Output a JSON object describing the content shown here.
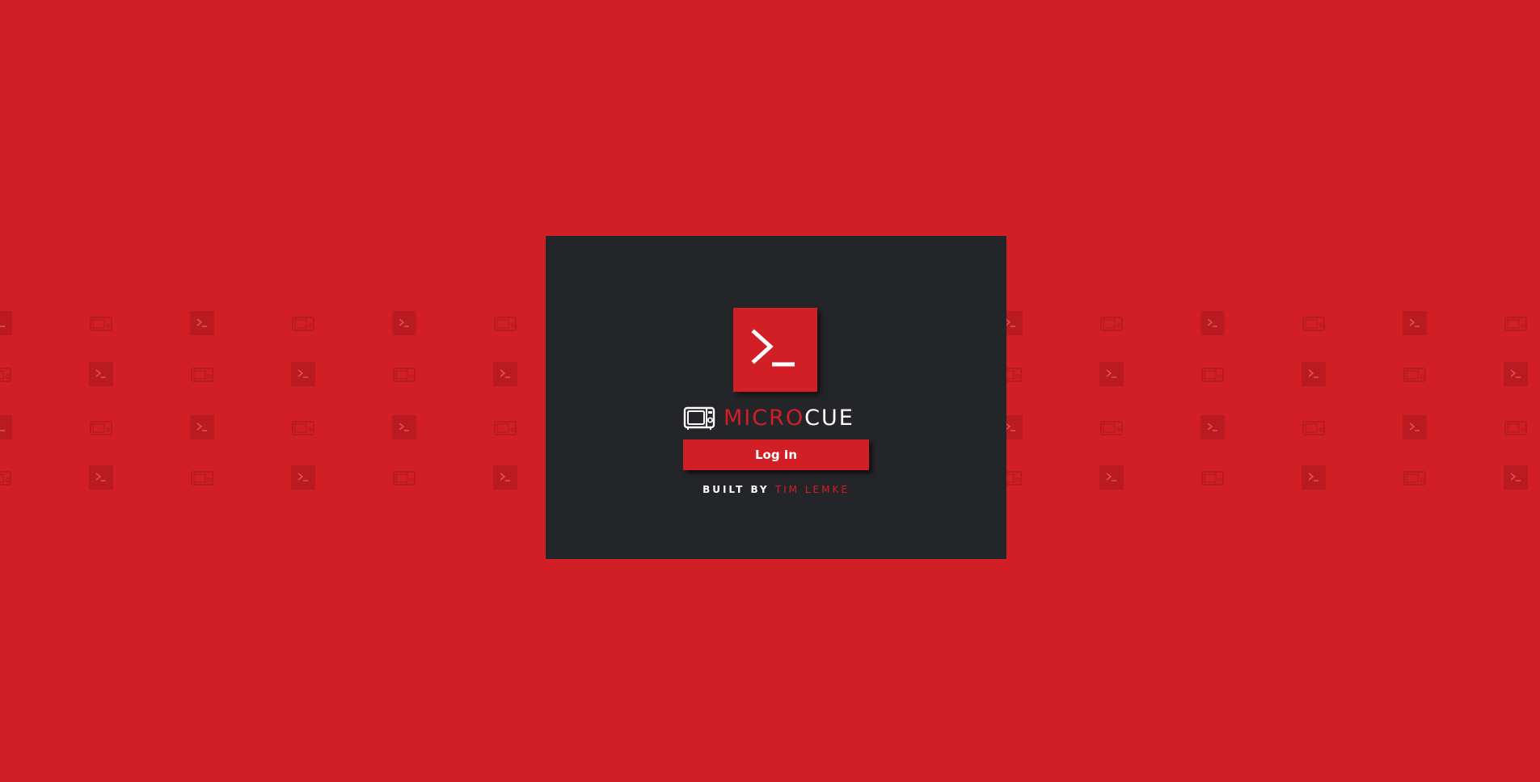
{
  "colors": {
    "background": "#d21f26",
    "card": "#242528",
    "accent": "#d21f26",
    "pattern_tile": "#b71b21",
    "text_light": "#ffffff"
  },
  "logo": {
    "icon": "terminal-prompt-icon"
  },
  "brand": {
    "icon": "microwave-icon",
    "name_part1": "MICRO",
    "name_part2": "CUE"
  },
  "login": {
    "button_label": "Log In"
  },
  "credit": {
    "prefix": "BUILT BY",
    "author": "TIM LEMKE"
  },
  "background_pattern": {
    "icons": [
      "terminal-prompt-icon",
      "microwave-icon"
    ]
  }
}
